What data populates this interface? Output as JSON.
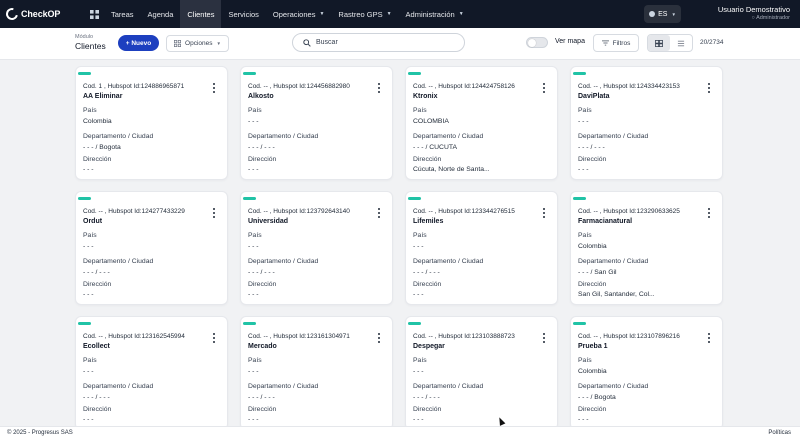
{
  "brand": {
    "name": "CheckOP"
  },
  "nav": {
    "items": [
      {
        "label": "Tareas"
      },
      {
        "label": "Agenda"
      },
      {
        "label": "Clientes",
        "active": true
      },
      {
        "label": "Servicios"
      },
      {
        "label": "Operaciones",
        "has_caret": true
      },
      {
        "label": "Rastreo GPS",
        "has_caret": true
      },
      {
        "label": "Administración",
        "has_caret": true
      }
    ],
    "home_icon": "home-grid-icon"
  },
  "language": {
    "value": "ES"
  },
  "user": {
    "name": "Usuario Demostrativo",
    "role": "Administrador"
  },
  "toolbar": {
    "module_label": "Módulo",
    "module_title": "Clientes",
    "new_button": "+ Nuevo",
    "options_button": "Opciones",
    "search_placeholder": "Buscar",
    "map_label": "Ver mapa",
    "map_toggle": false,
    "filters_button": "Filtros",
    "counter": "20/2734",
    "view_mode": "grid"
  },
  "card_labels": {
    "country": "País",
    "region": "Departamento / Ciudad",
    "address": "Dirección"
  },
  "clients": [
    {
      "code": "Cod. 1 , Hubspot Id:124886965871",
      "name": "AA Eliminar",
      "country": "Colombia",
      "region": "- - - / Bogota",
      "address": "- - -"
    },
    {
      "code": "Cod. -- , Hubspot Id:124456882980",
      "name": "Alkosto",
      "country": "- - -",
      "region": "- - - / - - -",
      "address": "- - -"
    },
    {
      "code": "Cod. -- , Hubspot Id:124424758126",
      "name": "Ktronix",
      "country": "COLOMBIA",
      "region": "- - - / CUCUTA",
      "address": "Cúcuta, Norte de Santa..."
    },
    {
      "code": "Cod. -- , Hubspot Id:124334423153",
      "name": "DaviPlata",
      "country": "- - -",
      "region": "- - - / - - -",
      "address": "- - -"
    },
    {
      "code": "Cod. -- , Hubspot Id:124277433229",
      "name": "Ordut",
      "country": "- - -",
      "region": "- - - / - - -",
      "address": "- - -"
    },
    {
      "code": "Cod. -- , Hubspot Id:123792643140",
      "name": "Universidad",
      "country": "- - -",
      "region": "- - - / - - -",
      "address": "- - -"
    },
    {
      "code": "Cod. -- , Hubspot Id:123344276515",
      "name": "Lifemiles",
      "country": "- - -",
      "region": "- - - / - - -",
      "address": "- - -"
    },
    {
      "code": "Cod. -- , Hubspot Id:123290633625",
      "name": "Farmacianatural",
      "country": "Colombia",
      "region": "- - - / San Gil",
      "address": "San Gil, Santander, Col..."
    },
    {
      "code": "Cod. -- , Hubspot Id:123162545994",
      "name": "Ecollect",
      "country": "- - -",
      "region": "- - - / - - -",
      "address": "- - -"
    },
    {
      "code": "Cod. -- , Hubspot Id:123161304971",
      "name": "Mercado",
      "country": "- - -",
      "region": "- - - / - - -",
      "address": "- - -"
    },
    {
      "code": "Cod. -- , Hubspot Id:123103888723",
      "name": "Despegar",
      "country": "- - -",
      "region": "- - - / - - -",
      "address": "- - -"
    },
    {
      "code": "Cod. -- , Hubspot Id:123107896216",
      "name": "Prueba 1",
      "country": "Colombia",
      "region": "- - - / Bogota",
      "address": "- - -"
    }
  ],
  "colors": {
    "nav_bg": "#111827",
    "primary": "#1d3fbf",
    "accent": "#20c3a6"
  },
  "footer": {
    "copyright": "© 2025 - Progresus SAS",
    "policies": "Políticas"
  }
}
